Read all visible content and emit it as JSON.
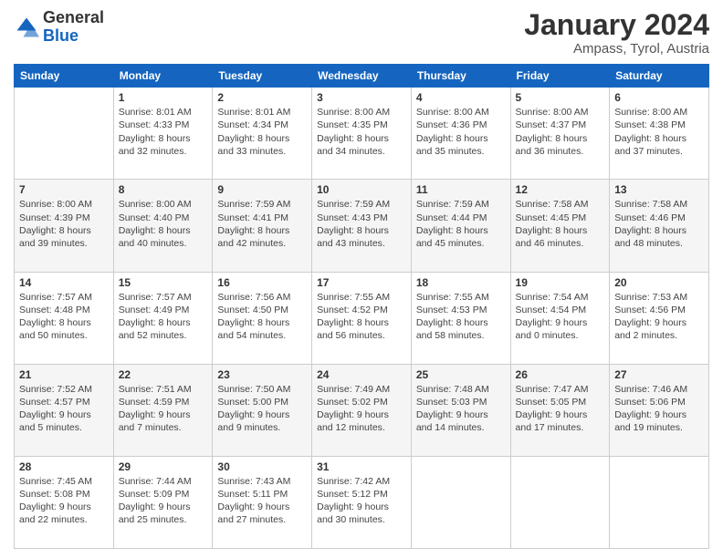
{
  "logo": {
    "line1": "General",
    "line2": "Blue"
  },
  "title": "January 2024",
  "location": "Ampass, Tyrol, Austria",
  "weekdays": [
    "Sunday",
    "Monday",
    "Tuesday",
    "Wednesday",
    "Thursday",
    "Friday",
    "Saturday"
  ],
  "weeks": [
    [
      {
        "day": "",
        "info": ""
      },
      {
        "day": "1",
        "info": "Sunrise: 8:01 AM\nSunset: 4:33 PM\nDaylight: 8 hours\nand 32 minutes."
      },
      {
        "day": "2",
        "info": "Sunrise: 8:01 AM\nSunset: 4:34 PM\nDaylight: 8 hours\nand 33 minutes."
      },
      {
        "day": "3",
        "info": "Sunrise: 8:00 AM\nSunset: 4:35 PM\nDaylight: 8 hours\nand 34 minutes."
      },
      {
        "day": "4",
        "info": "Sunrise: 8:00 AM\nSunset: 4:36 PM\nDaylight: 8 hours\nand 35 minutes."
      },
      {
        "day": "5",
        "info": "Sunrise: 8:00 AM\nSunset: 4:37 PM\nDaylight: 8 hours\nand 36 minutes."
      },
      {
        "day": "6",
        "info": "Sunrise: 8:00 AM\nSunset: 4:38 PM\nDaylight: 8 hours\nand 37 minutes."
      }
    ],
    [
      {
        "day": "7",
        "info": "Sunrise: 8:00 AM\nSunset: 4:39 PM\nDaylight: 8 hours\nand 39 minutes."
      },
      {
        "day": "8",
        "info": "Sunrise: 8:00 AM\nSunset: 4:40 PM\nDaylight: 8 hours\nand 40 minutes."
      },
      {
        "day": "9",
        "info": "Sunrise: 7:59 AM\nSunset: 4:41 PM\nDaylight: 8 hours\nand 42 minutes."
      },
      {
        "day": "10",
        "info": "Sunrise: 7:59 AM\nSunset: 4:43 PM\nDaylight: 8 hours\nand 43 minutes."
      },
      {
        "day": "11",
        "info": "Sunrise: 7:59 AM\nSunset: 4:44 PM\nDaylight: 8 hours\nand 45 minutes."
      },
      {
        "day": "12",
        "info": "Sunrise: 7:58 AM\nSunset: 4:45 PM\nDaylight: 8 hours\nand 46 minutes."
      },
      {
        "day": "13",
        "info": "Sunrise: 7:58 AM\nSunset: 4:46 PM\nDaylight: 8 hours\nand 48 minutes."
      }
    ],
    [
      {
        "day": "14",
        "info": "Sunrise: 7:57 AM\nSunset: 4:48 PM\nDaylight: 8 hours\nand 50 minutes."
      },
      {
        "day": "15",
        "info": "Sunrise: 7:57 AM\nSunset: 4:49 PM\nDaylight: 8 hours\nand 52 minutes."
      },
      {
        "day": "16",
        "info": "Sunrise: 7:56 AM\nSunset: 4:50 PM\nDaylight: 8 hours\nand 54 minutes."
      },
      {
        "day": "17",
        "info": "Sunrise: 7:55 AM\nSunset: 4:52 PM\nDaylight: 8 hours\nand 56 minutes."
      },
      {
        "day": "18",
        "info": "Sunrise: 7:55 AM\nSunset: 4:53 PM\nDaylight: 8 hours\nand 58 minutes."
      },
      {
        "day": "19",
        "info": "Sunrise: 7:54 AM\nSunset: 4:54 PM\nDaylight: 9 hours\nand 0 minutes."
      },
      {
        "day": "20",
        "info": "Sunrise: 7:53 AM\nSunset: 4:56 PM\nDaylight: 9 hours\nand 2 minutes."
      }
    ],
    [
      {
        "day": "21",
        "info": "Sunrise: 7:52 AM\nSunset: 4:57 PM\nDaylight: 9 hours\nand 5 minutes."
      },
      {
        "day": "22",
        "info": "Sunrise: 7:51 AM\nSunset: 4:59 PM\nDaylight: 9 hours\nand 7 minutes."
      },
      {
        "day": "23",
        "info": "Sunrise: 7:50 AM\nSunset: 5:00 PM\nDaylight: 9 hours\nand 9 minutes."
      },
      {
        "day": "24",
        "info": "Sunrise: 7:49 AM\nSunset: 5:02 PM\nDaylight: 9 hours\nand 12 minutes."
      },
      {
        "day": "25",
        "info": "Sunrise: 7:48 AM\nSunset: 5:03 PM\nDaylight: 9 hours\nand 14 minutes."
      },
      {
        "day": "26",
        "info": "Sunrise: 7:47 AM\nSunset: 5:05 PM\nDaylight: 9 hours\nand 17 minutes."
      },
      {
        "day": "27",
        "info": "Sunrise: 7:46 AM\nSunset: 5:06 PM\nDaylight: 9 hours\nand 19 minutes."
      }
    ],
    [
      {
        "day": "28",
        "info": "Sunrise: 7:45 AM\nSunset: 5:08 PM\nDaylight: 9 hours\nand 22 minutes."
      },
      {
        "day": "29",
        "info": "Sunrise: 7:44 AM\nSunset: 5:09 PM\nDaylight: 9 hours\nand 25 minutes."
      },
      {
        "day": "30",
        "info": "Sunrise: 7:43 AM\nSunset: 5:11 PM\nDaylight: 9 hours\nand 27 minutes."
      },
      {
        "day": "31",
        "info": "Sunrise: 7:42 AM\nSunset: 5:12 PM\nDaylight: 9 hours\nand 30 minutes."
      },
      {
        "day": "",
        "info": ""
      },
      {
        "day": "",
        "info": ""
      },
      {
        "day": "",
        "info": ""
      }
    ]
  ]
}
